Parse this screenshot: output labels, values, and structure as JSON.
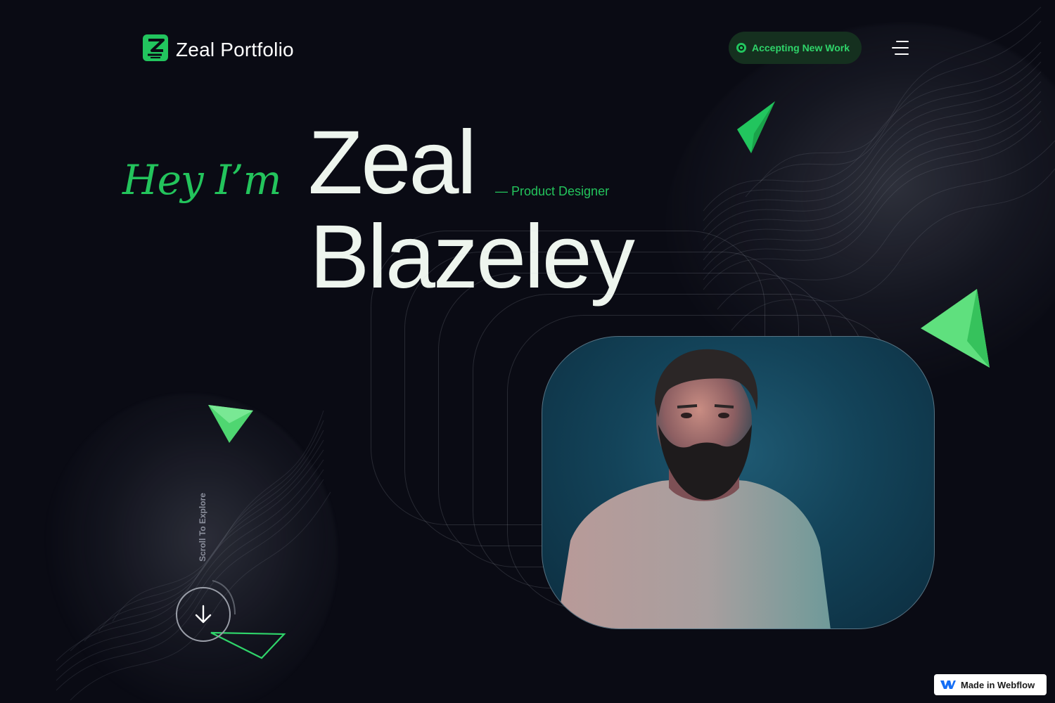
{
  "header": {
    "logo_text": "Zeal Portfolio",
    "status_label": "Accepting New Work"
  },
  "hero": {
    "greeting": "Hey I’m",
    "first_name": "Zeal",
    "last_name": "Blazeley",
    "role": "— Product Designer"
  },
  "scroll": {
    "label": "Scroll To Explore"
  },
  "badge": {
    "label": "Made in Webflow"
  },
  "colors": {
    "background": "#0a0b14",
    "accent": "#23c45c",
    "status_bg": "#15301f",
    "text": "#eef5ee"
  },
  "icons": [
    "zeal-logo-icon",
    "status-dot-icon",
    "hamburger-menu-icon",
    "arrow-down-icon",
    "webflow-logo-icon",
    "triangle-decoration"
  ]
}
